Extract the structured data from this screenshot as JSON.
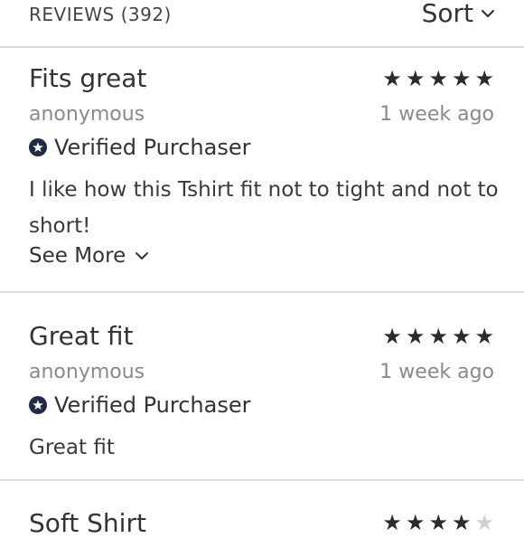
{
  "header": {
    "count_label": "REVIEWS (392)",
    "sort_label": "Sort"
  },
  "reviews": [
    {
      "title": "Fits great",
      "rating": 5,
      "author": "anonymous",
      "date": "1 week ago",
      "verified_label": "Verified Purchaser",
      "body_line1": "I like how this Tshirt fit not to tight and not to",
      "body_line2": "short!",
      "see_more_label": "See More"
    },
    {
      "title": "Great fit",
      "rating": 5,
      "author": "anonymous",
      "date": "1 week ago",
      "verified_label": "Verified Purchaser",
      "body": "Great fit"
    },
    {
      "title": "Soft Shirt",
      "rating": 4
    }
  ],
  "colors": {
    "star_filled": "#2b2b2b",
    "star_empty": "#d0d0d0",
    "verified_badge": "#1f2a44",
    "divider": "#dcdcdc"
  }
}
